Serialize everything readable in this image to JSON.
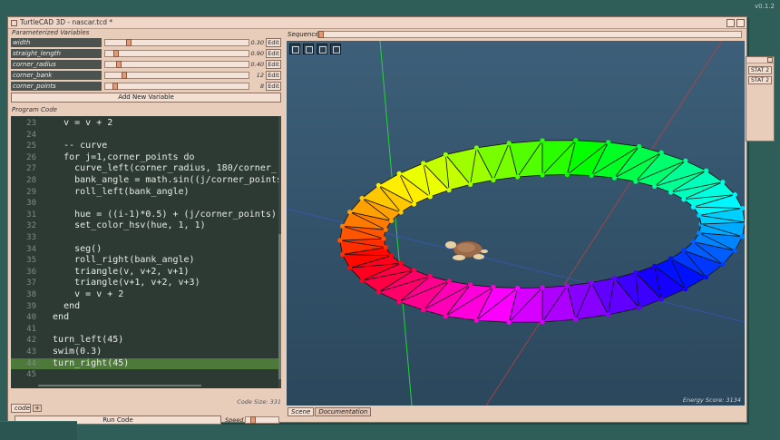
{
  "app": {
    "version": "v0.1.2",
    "window_title": "TurtleCAD 3D - nascar.tcd *"
  },
  "params": {
    "section_label": "Parameterized Variables",
    "add_label": "Add New Variable",
    "edit_label": "Edit",
    "variables": [
      {
        "name": "width",
        "value": "0.30",
        "level": 0.15
      },
      {
        "name": "straight_length",
        "value": "0.90",
        "level": 0.06
      },
      {
        "name": "corner_radius",
        "value": "0.40",
        "level": 0.08
      },
      {
        "name": "corner_bank",
        "value": "12",
        "level": 0.12
      },
      {
        "name": "corner_points",
        "value": "8",
        "level": 0.05
      }
    ]
  },
  "code": {
    "section_label": "Program Code",
    "lines": [
      {
        "n": "23",
        "t": "    v = v + 2"
      },
      {
        "n": "24",
        "t": ""
      },
      {
        "n": "25",
        "t": "    -- curve"
      },
      {
        "n": "26",
        "t": "    for j=1,corner_points do"
      },
      {
        "n": "27",
        "t": "      curve_left(corner_radius, 180/corner_"
      },
      {
        "n": "28",
        "t": "      bank_angle = math.sin((j/corner_points"
      },
      {
        "n": "29",
        "t": "      roll_left(bank_angle)"
      },
      {
        "n": "30",
        "t": ""
      },
      {
        "n": "31",
        "t": "      hue = ((i-1)*0.5) + (j/corner_points)"
      },
      {
        "n": "32",
        "t": "      set_color_hsv(hue, 1, 1)"
      },
      {
        "n": "33",
        "t": ""
      },
      {
        "n": "34",
        "t": "      seg()"
      },
      {
        "n": "35",
        "t": "      roll_right(bank_angle)"
      },
      {
        "n": "36",
        "t": "      triangle(v, v+2, v+1)"
      },
      {
        "n": "37",
        "t": "      triangle(v+1, v+2, v+3)"
      },
      {
        "n": "38",
        "t": "      v = v + 2"
      },
      {
        "n": "39",
        "t": "    end"
      },
      {
        "n": "40",
        "t": "  end"
      },
      {
        "n": "41",
        "t": ""
      },
      {
        "n": "42",
        "t": "  turn_left(45)"
      },
      {
        "n": "43",
        "t": "  swim(0.3)"
      },
      {
        "n": "44",
        "t": "  turn_right(45)"
      },
      {
        "n": "45",
        "t": ""
      }
    ],
    "highlight_line": "44",
    "code_size": "Code Size: 331",
    "tab_label": "code",
    "add_tab": "+"
  },
  "controls": {
    "run_label": "Run Code",
    "speed_label": "Speed",
    "speed_level": 0.15
  },
  "sequence": {
    "label": "Sequence",
    "level": 0.0
  },
  "scene": {
    "energy_score": "Energy Score: 3134",
    "tools": [
      "move-tool-icon",
      "frame-tool-icon",
      "focus-tool-icon",
      "grid-tool-icon"
    ],
    "tabs": [
      "Scene",
      "Documentation"
    ]
  },
  "stats": {
    "buttons": [
      "STAT 2",
      "STAT 2"
    ]
  }
}
